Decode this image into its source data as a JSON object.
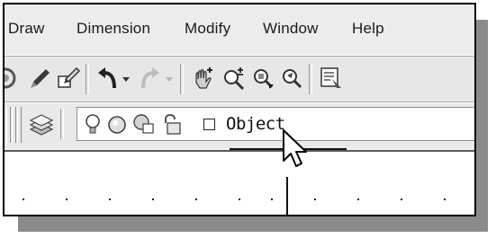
{
  "menubar": {
    "items": [
      "Draw",
      "Dimension",
      "Modify",
      "Window",
      "Help"
    ]
  },
  "toolbar": {
    "icons": [
      "partial-round-icon",
      "brush-icon",
      "match-properties-icon",
      "undo-icon",
      "undo-dropdown-icon",
      "redo-icon",
      "redo-dropdown-icon",
      "pan-realtime-icon",
      "zoom-realtime-icon",
      "zoom-window-icon",
      "zoom-previous-icon",
      "properties-icon"
    ]
  },
  "layers": {
    "current_layer": "Object",
    "icons": [
      "layers-icon",
      "lightbulb-icon",
      "sun-icon",
      "freeze-viewport-icon",
      "lock-icon",
      "color-swatch-icon"
    ]
  },
  "colors": {
    "background": "#f2f2f2",
    "frame_border": "#000000",
    "shadow": "#8a8a8a",
    "drawing_area": "#ffffff"
  }
}
